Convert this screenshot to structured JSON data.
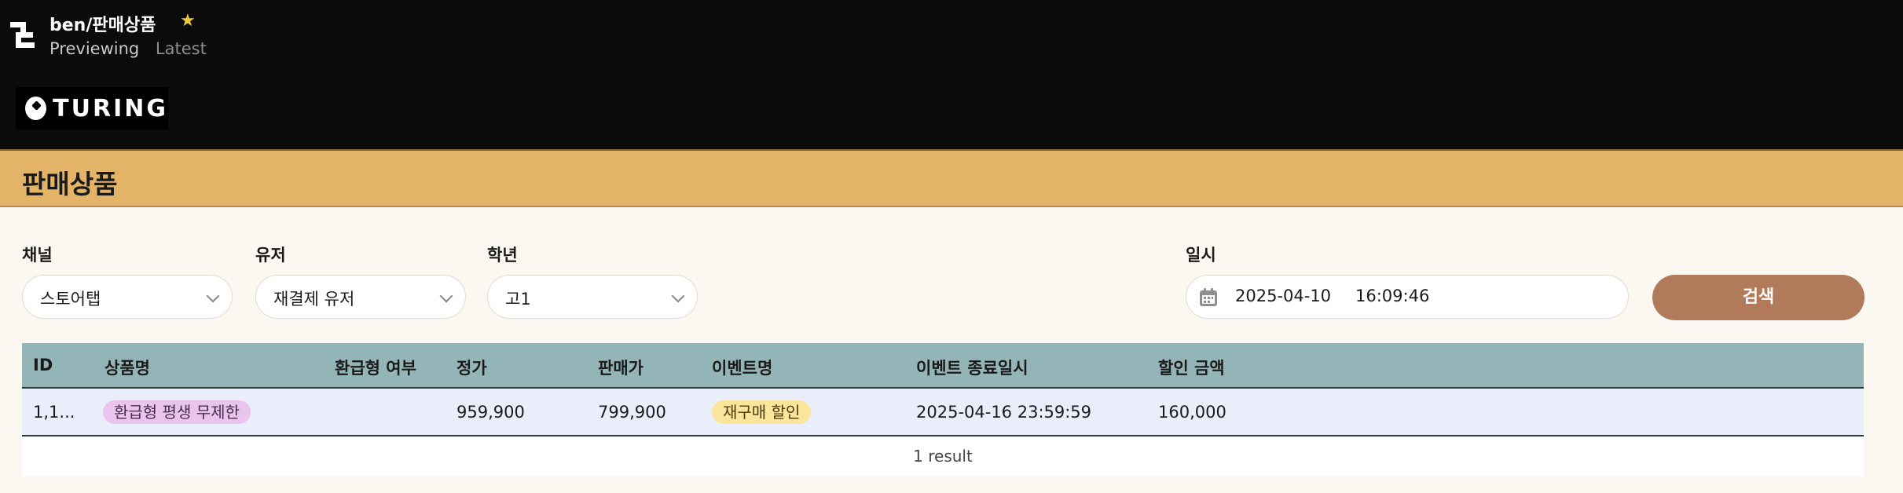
{
  "header": {
    "title": "ben/판매상품",
    "previewing": "Previewing",
    "latest": "Latest",
    "brand": "TURING",
    "star_color": "#f3c73b"
  },
  "page": {
    "title": "판매상품"
  },
  "filters": {
    "channel": {
      "label": "채널",
      "value": "스토어탭"
    },
    "user": {
      "label": "유저",
      "value": "재결제 유저"
    },
    "grade": {
      "label": "학년",
      "value": "고1"
    },
    "datetime": {
      "label": "일시",
      "date": "2025-04-10",
      "time": "16:09:46"
    },
    "search_label": "검색"
  },
  "table": {
    "columns": [
      "ID",
      "상품명",
      "환급형 여부",
      "정가",
      "판매가",
      "이벤트명",
      "이벤트 종료일시",
      "할인 금액"
    ],
    "rows": [
      {
        "id": "1,1...",
        "product": "환급형 평생 무제한",
        "refundable": "",
        "list_price": "959,900",
        "sale_price": "799,900",
        "event": "재구매 할인",
        "event_end": "2025-04-16 23:59:59",
        "discount": "160,000"
      }
    ],
    "footer": "1 result"
  },
  "colors": {
    "accent": "#e3b368",
    "header_bg": "#0b0b0b",
    "table_header": "#94b5b8",
    "button": "#b07a5b"
  }
}
